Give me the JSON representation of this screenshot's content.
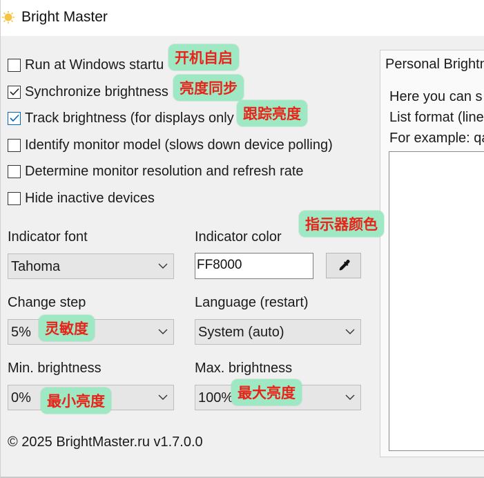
{
  "window": {
    "title": "Bright Master",
    "icon": "sun-icon",
    "accent": "#0067c0"
  },
  "options": {
    "run_at_startup": {
      "label": "Run at Windows startu",
      "checked": false
    },
    "synchronize_brightness": {
      "label": "Synchronize brightness",
      "checked": true
    },
    "track_brightness": {
      "label": "Track brightness (for displays only",
      "checked": true
    },
    "identify_model": {
      "label": "Identify monitor model (slows down device polling)",
      "checked": false
    },
    "determine_resolution": {
      "label": "Determine monitor resolution and refresh rate",
      "checked": false
    },
    "hide_inactive": {
      "label": "Hide inactive devices",
      "checked": false
    }
  },
  "fields": {
    "indicator_font": {
      "label": "Indicator font",
      "value": "Tahoma"
    },
    "indicator_color": {
      "label": "Indicator color",
      "value": "FF8000",
      "picker_icon": "eyedropper-icon"
    },
    "change_step": {
      "label": "Change step",
      "value": "5%"
    },
    "language": {
      "label": "Language (restart)",
      "value": "System (auto)"
    },
    "min_brightness": {
      "label": "Min. brightness",
      "value": "0%"
    },
    "max_brightness": {
      "label": "Max. brightness",
      "value": "100%"
    }
  },
  "footer": {
    "text": "© 2025 BrightMaster.ru v1.7.0.0"
  },
  "personal_panel": {
    "title": "Personal Brightn",
    "lines": [
      "Here you can s",
      "List format (line",
      "For example: qa"
    ],
    "textarea_value": ""
  },
  "annotations": {
    "startup": "开机自启",
    "sync": "亮度同步",
    "track": "跟踪亮度",
    "color": "指示器颜色",
    "step": "灵敏度",
    "min": "最小亮度",
    "max": "最大亮度",
    "tag_bg": "#9fe8c4",
    "tag_fg": "#e8231a"
  }
}
